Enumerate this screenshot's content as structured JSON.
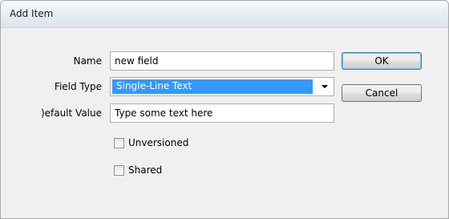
{
  "dialog": {
    "title": "Add Item"
  },
  "form": {
    "name_label": "Name",
    "name_value": "new field",
    "field_type_label": "Field Type",
    "field_type_value": "Single-Line Text",
    "default_value_label": ")efault Value",
    "default_value_value": "Type some text here",
    "unversioned_label": "Unversioned",
    "unversioned_checked": false,
    "shared_label": "Shared",
    "shared_checked": false
  },
  "buttons": {
    "ok_label": "OK",
    "cancel_label": "Cancel"
  },
  "icons": {
    "dropdown": "chevron-down-icon"
  },
  "colors": {
    "selection": "#3399ff",
    "titlebar": "#dbe4ee",
    "background": "#f0f0f0"
  }
}
